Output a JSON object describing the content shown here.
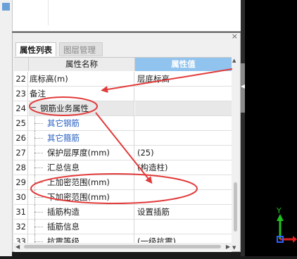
{
  "panel": {
    "close_glyph": "×",
    "tabs": [
      {
        "label": "属性列表",
        "active": true
      },
      {
        "label": "图层管理",
        "active": false
      }
    ],
    "columns": {
      "name": "属性名称",
      "value": "属性值"
    }
  },
  "rows": [
    {
      "num": "22",
      "name": "底标高(m)",
      "value": "层底标高",
      "style": "plain"
    },
    {
      "num": "23",
      "name": "备注",
      "value": "",
      "style": "plain"
    },
    {
      "num": "24",
      "name": "钢筋业务属性",
      "value": "",
      "style": "group"
    },
    {
      "num": "25",
      "name": "其它钢筋",
      "value": "",
      "style": "child-blue"
    },
    {
      "num": "26",
      "name": "其它箍筋",
      "value": "",
      "style": "child-blue"
    },
    {
      "num": "27",
      "name": "保护层厚度(mm)",
      "value": "(25)",
      "style": "child"
    },
    {
      "num": "28",
      "name": "汇总信息",
      "value": "(构造柱)",
      "style": "child"
    },
    {
      "num": "29",
      "name": "上加密范围(mm)",
      "value": "",
      "style": "child"
    },
    {
      "num": "30",
      "name": "下加密范围(mm)",
      "value": "",
      "style": "child"
    },
    {
      "num": "31",
      "name": "插筋构造",
      "value": "设置插筋",
      "style": "child"
    },
    {
      "num": "32",
      "name": "插筋信息",
      "value": "",
      "style": "child"
    },
    {
      "num": "33",
      "name": "抗震等级",
      "value": "(一级抗震)",
      "style": "child"
    }
  ],
  "viewport": {
    "axis_y_label": "Y",
    "axis_x_color": "#e02020",
    "axis_y_color": "#20c020",
    "axis_z_color": "#3060ff"
  },
  "annotations": {
    "color": "#e23b3b"
  }
}
